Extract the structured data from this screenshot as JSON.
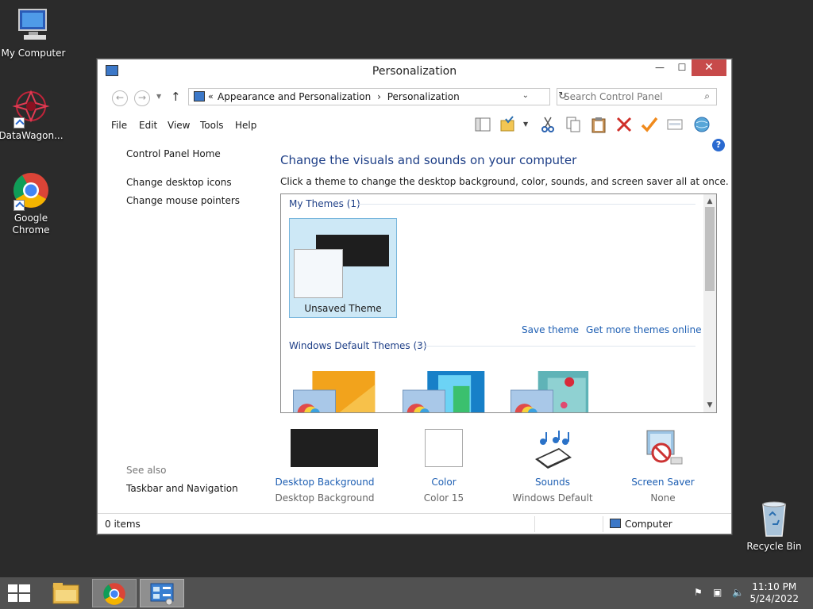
{
  "desktop": {
    "icons": [
      {
        "label": "My Computer"
      },
      {
        "label": "DataWagon..."
      },
      {
        "label": "Google Chrome"
      },
      {
        "label": "Recycle Bin"
      }
    ]
  },
  "window": {
    "title": "Personalization",
    "controls": {
      "minimize": "—",
      "maximize": "☐",
      "close": "✕"
    },
    "address": {
      "prefix": "«",
      "crumbs": [
        "Appearance and Personalization",
        "Personalization"
      ],
      "separator": "›"
    },
    "search": {
      "placeholder": "Search Control Panel"
    },
    "menu": [
      "File",
      "Edit",
      "View",
      "Tools",
      "Help"
    ],
    "sidebar": {
      "home": "Control Panel Home",
      "links": [
        "Change desktop icons",
        "Change mouse pointers"
      ],
      "see_also": "See also",
      "see_also_links": [
        "Taskbar and Navigation"
      ]
    },
    "main": {
      "heading": "Change the visuals and sounds on your computer",
      "description": "Click a theme to change the desktop background, color, sounds, and screen saver all at once."
    },
    "themes": {
      "my_themes_header": "My Themes (1)",
      "unsaved_theme": "Unsaved Theme",
      "save_theme": "Save theme",
      "get_more": "Get more themes online",
      "default_header": "Windows Default Themes (3)"
    },
    "bottom": [
      {
        "title": "Desktop Background",
        "sub": "Desktop Background"
      },
      {
        "title": "Color",
        "sub": "Color 15"
      },
      {
        "title": "Sounds",
        "sub": "Windows Default"
      },
      {
        "title": "Screen Saver",
        "sub": "None"
      }
    ],
    "status": {
      "items": "0 items",
      "location": "Computer"
    }
  },
  "taskbar": {
    "time": "11:10 PM",
    "date": "5/24/2022"
  },
  "colors": {
    "accent_link": "#1e5fb3",
    "heading": "#1e3f87",
    "close": "#c74a4a",
    "selected_tile": "#cde8f6"
  }
}
